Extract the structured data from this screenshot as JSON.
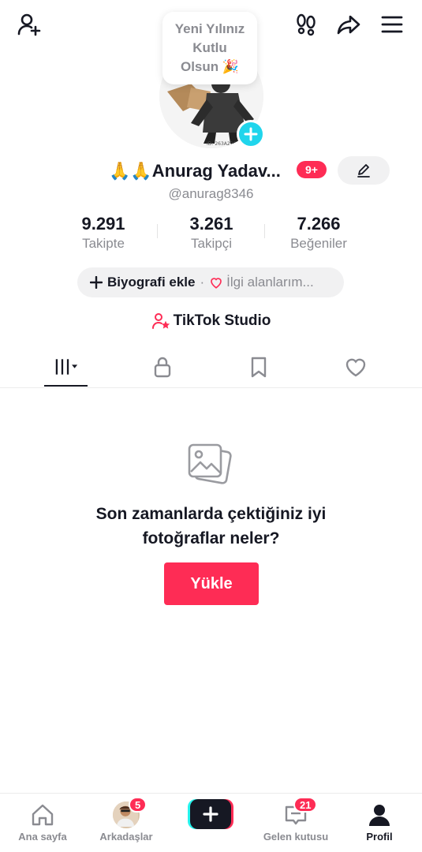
{
  "note": {
    "line1": "Yeni Yılınız",
    "line2": "Kutlu",
    "line3": "Olsun 🎉"
  },
  "profile": {
    "display_name": "🙏🙏Anurag Yadav...",
    "notification_badge": "9+",
    "username": "@anurag8346"
  },
  "stats": [
    {
      "value": "9.291",
      "label": "Takipte"
    },
    {
      "value": "3.261",
      "label": "Takipçi"
    },
    {
      "value": "7.266",
      "label": "Beğeniler"
    }
  ],
  "bio": {
    "add_label": "Biyografi ekle",
    "separator": "·",
    "interests_label": "İlgi alanlarım..."
  },
  "studio": {
    "label": "TikTok Studio"
  },
  "empty_state": {
    "line1": "Son zamanlarda çektiğiniz iyi",
    "line2": "fotoğraflar neler?",
    "button": "Yükle"
  },
  "bottom_nav": {
    "home": "Ana sayfa",
    "friends": "Arkadaşlar",
    "friends_badge": "5",
    "inbox": "Gelen kutusu",
    "inbox_badge": "21",
    "profile": "Profil"
  },
  "colors": {
    "accent": "#fe2c55",
    "cyan": "#25f4ee",
    "text": "#161823",
    "muted": "#8a8b91"
  },
  "icons": {
    "top_left": "add-friend-icon",
    "top_right": [
      "footprints-icon",
      "share-icon",
      "menu-icon"
    ],
    "tabs": [
      "grid-icon",
      "lock-icon",
      "bookmark-icon",
      "heart-icon"
    ]
  }
}
